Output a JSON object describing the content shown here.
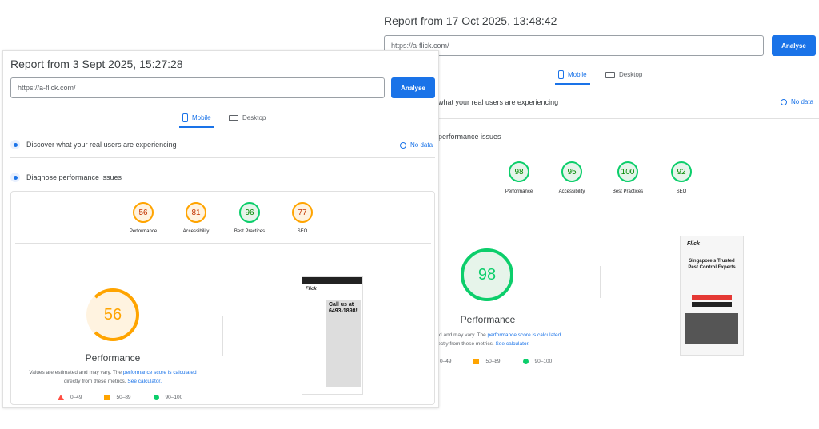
{
  "after": {
    "title": "Report from 17 Oct 2025, 13:48:42",
    "url": "https://a-flick.com/",
    "analyse": "Analyse",
    "tabs": [
      "Mobile",
      "Desktop"
    ],
    "field_row": "what your real users are experiencing",
    "no_data": "No data",
    "diagnose": "performance issues",
    "scores": [
      {
        "label": "Performance",
        "value": "98"
      },
      {
        "label": "Accessibility",
        "value": "95"
      },
      {
        "label": "Best Practices",
        "value": "100"
      },
      {
        "label": "SEO",
        "value": "92"
      }
    ],
    "big_score": "98",
    "big_label": "Performance",
    "note1": "ated and may vary. The ",
    "note_link1": "performance score is calculated",
    "note2": "directly from these metrics. ",
    "note_link2": "See calculator.",
    "legend": [
      "0–49",
      "50–89",
      "90–100"
    ],
    "shot": {
      "brand": "Flick",
      "headline": "Singapore's Trusted Pest Control Experts"
    }
  },
  "before": {
    "title": "Report from 3 Sept 2025, 15:27:28",
    "url": "https://a-flick.com/",
    "analyse": "Analyse",
    "tabs": [
      "Mobile",
      "Desktop"
    ],
    "field_row": "Discover what your real users are experiencing",
    "no_data": "No data",
    "diagnose": "Diagnose performance issues",
    "scores": [
      {
        "label": "Performance",
        "value": "56"
      },
      {
        "label": "Accessibility",
        "value": "81"
      },
      {
        "label": "Best Practices",
        "value": "96"
      },
      {
        "label": "SEO",
        "value": "77"
      }
    ],
    "big_score": "56",
    "big_label": "Performance",
    "note1": "Values are estimated and may vary. The ",
    "note_link1": "performance score is calculated",
    "note2": "directly from these metrics. ",
    "note_link2": "See calculator.",
    "legend": [
      "0–49",
      "50–89",
      "90–100"
    ],
    "shot": {
      "brand": "Flick",
      "headline": "Call us at 6493-1898!"
    }
  },
  "colors": {
    "fail": "#ff4e42",
    "average": "#ffa400",
    "pass": "#0cce6b",
    "accent": "#1a73e8",
    "arrow": "#e3161b"
  }
}
